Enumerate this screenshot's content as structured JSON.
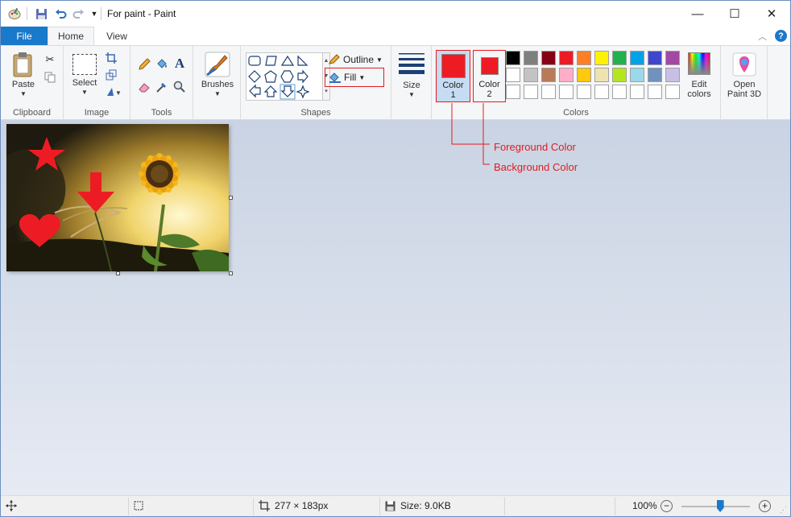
{
  "window": {
    "title": "For paint - Paint",
    "minimize": "—",
    "maximize": "☐",
    "close": "✕"
  },
  "tabs": {
    "file": "File",
    "home": "Home",
    "view": "View"
  },
  "ribbon": {
    "clipboard": {
      "label": "Clipboard",
      "paste": "Paste"
    },
    "image": {
      "label": "Image",
      "select": "Select"
    },
    "tools": {
      "label": "Tools"
    },
    "brushes": {
      "label": "Brushes"
    },
    "shapes": {
      "label": "Shapes",
      "outline": "Outline",
      "fill": "Fill"
    },
    "size": {
      "label": "Size"
    },
    "colors": {
      "label": "Colors",
      "color1_a": "Color",
      "color1_b": "1",
      "color2_a": "Color",
      "color2_b": "2",
      "edit_a": "Edit",
      "edit_b": "colors",
      "color1_value": "#ed1c24",
      "color2_value": "#ed1c24"
    },
    "paint3d": {
      "a": "Open",
      "b": "Paint 3D"
    }
  },
  "palette": {
    "row1": [
      "#000000",
      "#7f7f7f",
      "#880015",
      "#ed1c24",
      "#ff7f27",
      "#fff200",
      "#22b14c",
      "#00a2e8",
      "#3f48cc",
      "#a349a4"
    ],
    "row2": [
      "#ffffff",
      "#c3c3c3",
      "#b97a57",
      "#ffaec9",
      "#ffc90e",
      "#efe4b0",
      "#b5e61d",
      "#99d9ea",
      "#7092be",
      "#c8bfe7"
    ],
    "row3": [
      "#ffffff",
      "#ffffff",
      "#ffffff",
      "#ffffff",
      "#ffffff",
      "#ffffff",
      "#ffffff",
      "#ffffff",
      "#ffffff",
      "#ffffff"
    ]
  },
  "annotations": {
    "foreground": "Foreground Color",
    "background": "Background Color"
  },
  "status": {
    "dimensions": "277 × 183px",
    "size": "Size: 9.0KB",
    "zoom": "100%",
    "zoom_fraction": 0.56
  }
}
